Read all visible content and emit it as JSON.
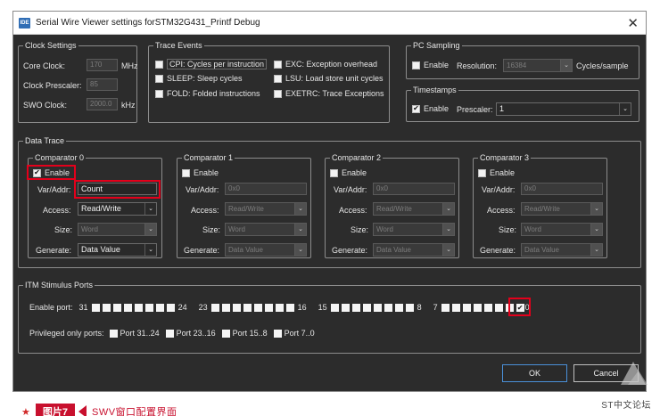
{
  "window": {
    "title": "Serial Wire Viewer settings forSTM32G431_Printf Debug",
    "app_icon_text": "IDE",
    "close": "✕"
  },
  "clock": {
    "legend": "Clock Settings",
    "core_label": "Core Clock:",
    "core_value": "170",
    "core_unit": "MHz",
    "prescaler_label": "Clock Prescaler:",
    "prescaler_value": "85",
    "swo_label": "SWO Clock:",
    "swo_value": "2000.0",
    "swo_unit": "kHz"
  },
  "trace_events": {
    "legend": "Trace Events",
    "items": [
      {
        "label": "CPI: Cycles per instruction",
        "checked": false
      },
      {
        "label": "EXC: Exception overhead",
        "checked": false
      },
      {
        "label": "SLEEP: Sleep cycles",
        "checked": false
      },
      {
        "label": "LSU: Load store unit cycles",
        "checked": false
      },
      {
        "label": "FOLD: Folded instructions",
        "checked": false
      },
      {
        "label": "EXETRC: Trace Exceptions",
        "checked": false
      }
    ]
  },
  "pc_sampling": {
    "legend": "PC Sampling",
    "enable_label": "Enable",
    "enabled": false,
    "resolution_label": "Resolution:",
    "resolution_value": "16384",
    "unit": "Cycles/sample"
  },
  "timestamps": {
    "legend": "Timestamps",
    "enable_label": "Enable",
    "enabled": true,
    "prescaler_label": "Prescaler:",
    "prescaler_value": "1"
  },
  "data_trace": {
    "legend": "Data Trace",
    "enable_label": "Enable",
    "var_label": "Var/Addr:",
    "access_label": "Access:",
    "size_label": "Size:",
    "generate_label": "Generate:",
    "comparators": [
      {
        "legend": "Comparator 0",
        "enabled": true,
        "addr": "Count",
        "access": "Read/Write",
        "size": "Word",
        "generate": "Data Value"
      },
      {
        "legend": "Comparator 1",
        "enabled": false,
        "addr": "0x0",
        "access": "Read/Write",
        "size": "Word",
        "generate": "Data Value"
      },
      {
        "legend": "Comparator 2",
        "enabled": false,
        "addr": "0x0",
        "access": "Read/Write",
        "size": "Word",
        "generate": "Data Value"
      },
      {
        "legend": "Comparator 3",
        "enabled": false,
        "addr": "0x0",
        "access": "Read/Write",
        "size": "Word",
        "generate": "Data Value"
      }
    ]
  },
  "itm": {
    "legend": "ITM Stimulus Ports",
    "enable_port_label": "Enable port:",
    "group_labels": [
      "31",
      "24",
      "23",
      "16",
      "15",
      "8",
      "7",
      "0"
    ],
    "port0_enabled": true,
    "privileged_label": "Privileged only ports:",
    "privileged": [
      "Port 31..24",
      "Port 23..16",
      "Port 15..8",
      "Port 7..0"
    ]
  },
  "buttons": {
    "ok": "OK",
    "cancel": "Cancel"
  },
  "watermark": "ST中文论坛",
  "caption": {
    "star": "★",
    "tag": "图片7",
    "text": "SWV窗口配置界面"
  },
  "icons": {
    "check": "✔",
    "dropdown": "⌄",
    "close": "close-icon"
  },
  "colors": {
    "dialog_bg": "#2c2c2c",
    "highlight_red": "#e3001b",
    "caption_red": "#c8102e",
    "ok_border": "#4a90d9"
  }
}
